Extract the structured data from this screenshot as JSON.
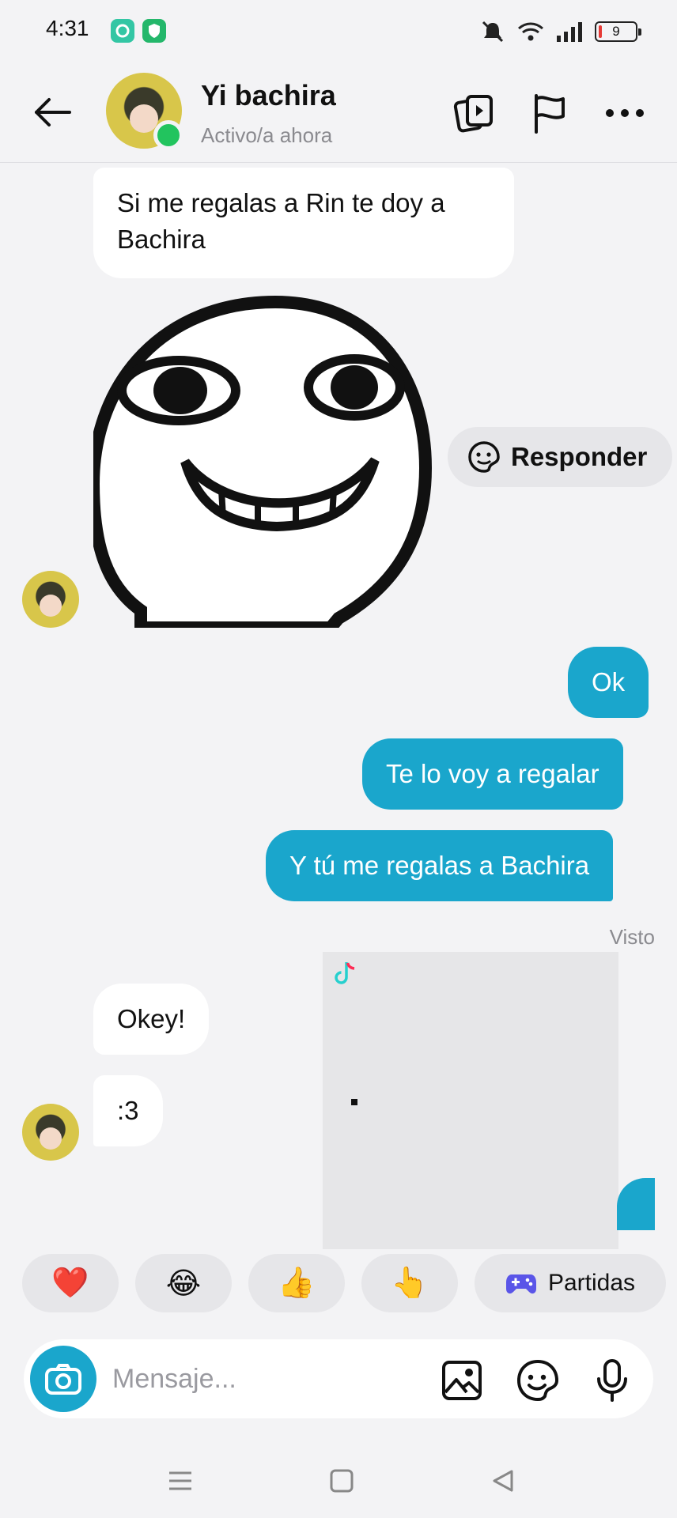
{
  "status_bar": {
    "time": "4:31",
    "battery": "9",
    "icons": [
      "messenger-icon",
      "shield-icon",
      "mute-icon",
      "wifi-icon",
      "signal-icon",
      "battery-icon"
    ]
  },
  "header": {
    "name": "Yi bachira",
    "status": "Activo/a ahora",
    "icons": [
      "back-arrow-icon",
      "video-cards-icon",
      "flag-icon",
      "more-icon"
    ]
  },
  "messages": {
    "m1": "Si me regalas a Rin te doy a",
    "m1b": "Bachira",
    "reply_chip": "Responder",
    "o1": "Ok",
    "o2": "Te lo voy a regalar",
    "o3": "Y tú me regalas a Bachira",
    "seen": "Visto",
    "i1": "Okey!",
    "i2": ":3"
  },
  "reactions": {
    "heart": "❤️",
    "laugh": "😂",
    "thumbs": "👍",
    "point": "👆",
    "games_label": "Partidas"
  },
  "composer": {
    "placeholder": "Mensaje..."
  },
  "colors": {
    "accent": "#1aa6cc",
    "online": "#22c45e",
    "background": "#f3f3f5"
  }
}
